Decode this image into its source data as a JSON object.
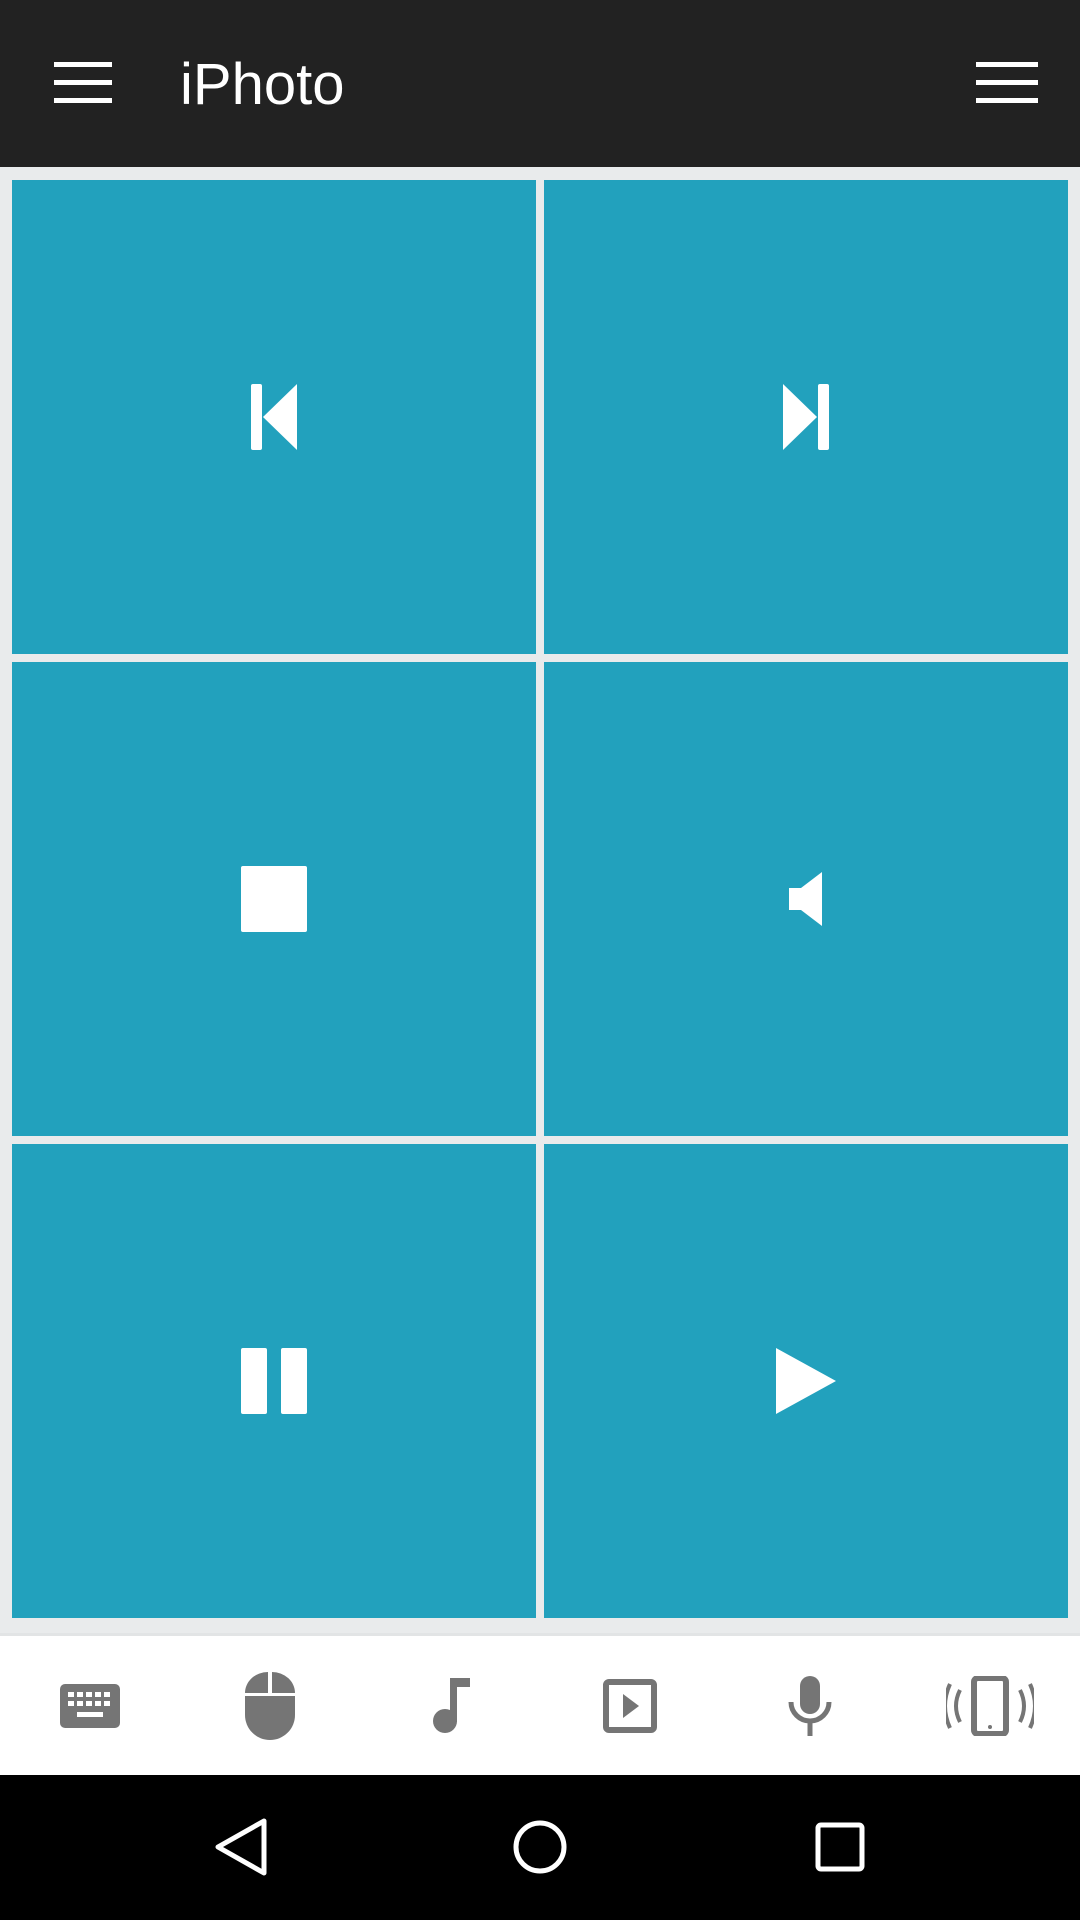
{
  "app_bar": {
    "title": "iPhoto",
    "left_icon": "hamburger-menu-icon",
    "right_icon": "hamburger-menu-icon"
  },
  "controls": [
    {
      "name": "previous-track",
      "icon": "skip-previous-icon"
    },
    {
      "name": "next-track",
      "icon": "skip-next-icon"
    },
    {
      "name": "stop",
      "icon": "stop-icon"
    },
    {
      "name": "volume",
      "icon": "volume-mute-icon"
    },
    {
      "name": "pause",
      "icon": "pause-icon"
    },
    {
      "name": "play",
      "icon": "play-icon"
    }
  ],
  "bottom_tabs": [
    {
      "name": "keyboard",
      "icon": "keyboard-icon"
    },
    {
      "name": "mouse",
      "icon": "mouse-icon"
    },
    {
      "name": "music",
      "icon": "music-note-icon"
    },
    {
      "name": "slideshow",
      "icon": "slideshow-icon"
    },
    {
      "name": "microphone",
      "icon": "microphone-icon"
    },
    {
      "name": "vibrate",
      "icon": "vibrate-phone-icon"
    }
  ],
  "system_nav": [
    {
      "name": "back",
      "icon": "back-triangle-icon"
    },
    {
      "name": "home",
      "icon": "home-circle-icon"
    },
    {
      "name": "recents",
      "icon": "recents-square-icon"
    }
  ],
  "colors": {
    "app_bar": "#222222",
    "tile": "#22a1bd",
    "grid_gap": "#e9ebec",
    "tab_icon": "#757575",
    "nav_bar": "#000000"
  }
}
